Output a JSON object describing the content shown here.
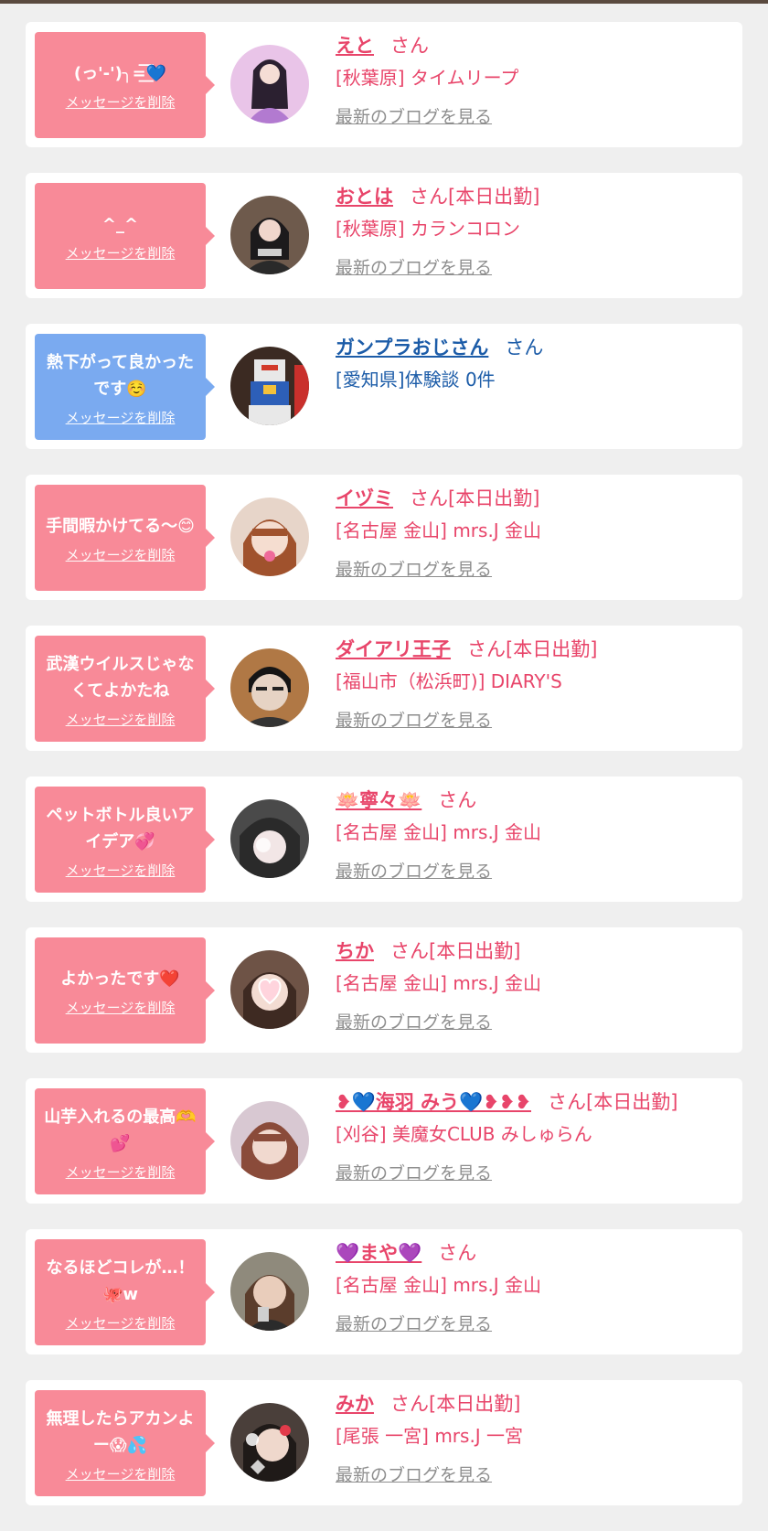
{
  "colors": {
    "pink_bubble": "#f88a98",
    "blue_bubble": "#7aaaf0",
    "pink_text": "#e8456a",
    "blue_text": "#1c5ca8",
    "link_gray": "#8e8e8e"
  },
  "items": [
    {
      "message": "(っ'-')╮=͟͟͞͞💙",
      "delete_label": "メッセージを削除",
      "name": "えと",
      "suffix": "さん",
      "store": "[秋葉原] タイムリープ",
      "blog_label": "最新のブログを見る",
      "bubble_color": "pink",
      "text_color": "pink"
    },
    {
      "message": "^_^",
      "delete_label": "メッセージを削除",
      "name": "おとは",
      "suffix": "さん[本日出勤]",
      "store": "[秋葉原] カランコロン",
      "blog_label": "最新のブログを見る",
      "bubble_color": "pink",
      "text_color": "pink"
    },
    {
      "message": "熱下がって良かったです☺️",
      "delete_label": "メッセージを削除",
      "name": "ガンプラおじさん",
      "suffix": "さん",
      "store": "[愛知県]体験談 0件",
      "blog_label": "",
      "bubble_color": "blue",
      "text_color": "blue"
    },
    {
      "message": "手間暇かけてる〜😊",
      "delete_label": "メッセージを削除",
      "name": "イヅミ",
      "suffix": "さん[本日出勤]",
      "store": "[名古屋 金山] mrs.J 金山",
      "blog_label": "最新のブログを見る",
      "bubble_color": "pink",
      "text_color": "pink"
    },
    {
      "message": "武漢ウイルスじゃなくてよかたね",
      "delete_label": "メッセージを削除",
      "name": "ダイアリ王子",
      "suffix": "さん[本日出勤]",
      "store": "[福山市（松浜町)] DIARY'S",
      "blog_label": "最新のブログを見る",
      "bubble_color": "pink",
      "text_color": "pink"
    },
    {
      "message": "ペットボトル良いアイデア💞",
      "delete_label": "メッセージを削除",
      "name": "🪷寧々🪷",
      "suffix": "さん",
      "store": "[名古屋 金山] mrs.J 金山",
      "blog_label": "最新のブログを見る",
      "bubble_color": "pink",
      "text_color": "pink"
    },
    {
      "message": "よかったです❤️",
      "delete_label": "メッセージを削除",
      "name": "ちか",
      "suffix": "さん[本日出勤]",
      "store": "[名古屋 金山] mrs.J 金山",
      "blog_label": "最新のブログを見る",
      "bubble_color": "pink",
      "text_color": "pink"
    },
    {
      "message": "山芋入れるの最高🫶💕",
      "delete_label": "メッセージを削除",
      "name": "❥💙海羽 みう💙❥❥❥",
      "suffix": "さん[本日出勤]",
      "store": "[刈谷] 美魔女CLUB みしゅらん",
      "blog_label": "最新のブログを見る",
      "bubble_color": "pink",
      "text_color": "pink"
    },
    {
      "message": "なるほどコレが…！🐙w",
      "delete_label": "メッセージを削除",
      "name": "💜まや💜",
      "suffix": "さん",
      "store": "[名古屋 金山] mrs.J 金山",
      "blog_label": "最新のブログを見る",
      "bubble_color": "pink",
      "text_color": "pink"
    },
    {
      "message": "無理したらアカンよー😱💦",
      "delete_label": "メッセージを削除",
      "name": "みか",
      "suffix": "さん[本日出勤]",
      "store": "[尾張 一宮] mrs.J 一宮",
      "blog_label": "最新のブログを見る",
      "bubble_color": "pink",
      "text_color": "pink"
    }
  ]
}
